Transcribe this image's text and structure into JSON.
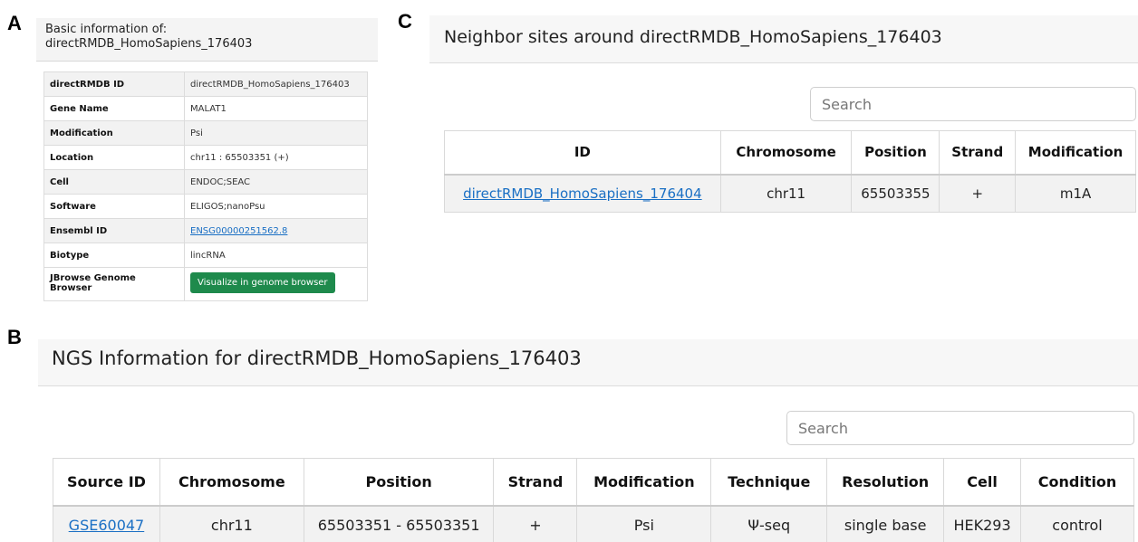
{
  "panels": {
    "a": "A",
    "b": "B",
    "c": "C"
  },
  "basic": {
    "title_line1": "Basic information of:",
    "title_line2": "directRMDB_HomoSapiens_176403",
    "rows": [
      {
        "key": "directRMDB ID",
        "value": "directRMDB_HomoSapiens_176403"
      },
      {
        "key": "Gene Name",
        "value": "MALAT1"
      },
      {
        "key": "Modification",
        "value": "Psi"
      },
      {
        "key": "Location",
        "value": "chr11 : 65503351 (+)"
      },
      {
        "key": "Cell",
        "value": "ENDOC;SEAC"
      },
      {
        "key": "Software",
        "value": "ELIGOS;nanoPsu"
      },
      {
        "key": "Ensembl ID",
        "value": "ENSG00000251562.8"
      },
      {
        "key": "Biotype",
        "value": "lincRNA"
      },
      {
        "key": "JBrowse Genome Browser",
        "value": "Visualize in genome browser"
      }
    ]
  },
  "neighbor": {
    "title": "Neighbor sites around directRMDB_HomoSapiens_176403",
    "search_placeholder": "Search",
    "columns": [
      "ID",
      "Chromosome",
      "Position",
      "Strand",
      "Modification"
    ],
    "rows": [
      [
        "directRMDB_HomoSapiens_176404",
        "chr11",
        "65503355",
        "+",
        "m1A"
      ]
    ]
  },
  "ngs": {
    "title": "NGS Information for directRMDB_HomoSapiens_176403",
    "search_placeholder": "Search",
    "columns": [
      "Source ID",
      "Chromosome",
      "Position",
      "Strand",
      "Modification",
      "Technique",
      "Resolution",
      "Cell",
      "Condition"
    ],
    "rows": [
      [
        "GSE60047",
        "chr11",
        "65503351 - 65503351",
        "+",
        "Psi",
        "Ψ-seq",
        "single base",
        "HEK293",
        "control"
      ]
    ]
  },
  "colors": {
    "link": "#1a6fc4",
    "button": "#1e8a4c",
    "row_alt": "#f2f2f2"
  }
}
